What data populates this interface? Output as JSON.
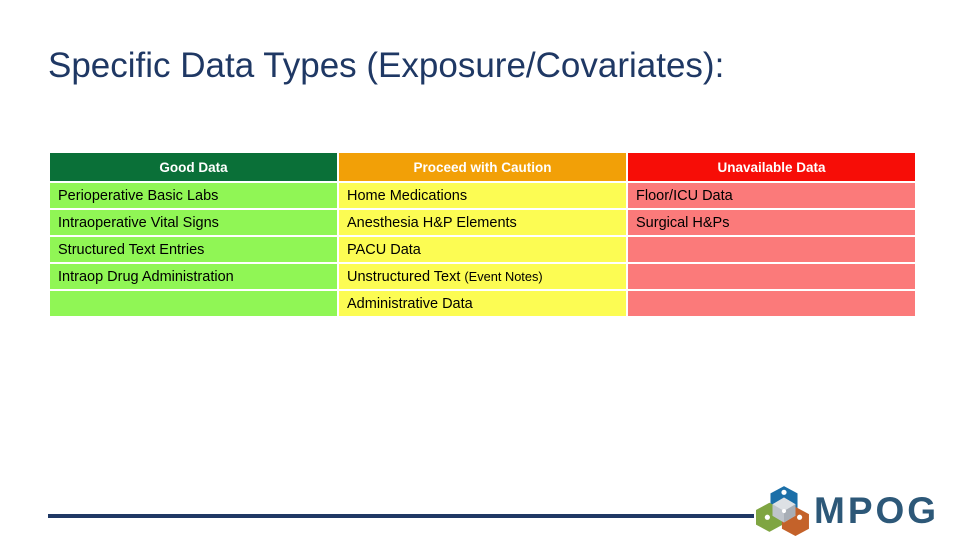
{
  "slide": {
    "title": "Specific Data Types (Exposure/Covariates):",
    "background_color": "#FFFFFF",
    "title_color": "#1F3864"
  },
  "table": {
    "headers": [
      {
        "label": "Good Data",
        "color": "#0A7038"
      },
      {
        "label": "Proceed with Caution",
        "color": "#F2A007"
      },
      {
        "label": "Unavailable Data",
        "color": "#F70D07"
      }
    ],
    "cell_colors": {
      "good": "#90F655",
      "caution": "#FCFC53",
      "unavailable": "#FB7A7A"
    },
    "rows": [
      {
        "good": "Perioperative Basic Labs",
        "caution": "Home Medications",
        "unavailable": "Floor/ICU Data"
      },
      {
        "good": "Intraoperative Vital Signs",
        "caution": "Anesthesia H&P Elements",
        "unavailable": "Surgical H&Ps"
      },
      {
        "good": "Structured Text Entries",
        "caution": "PACU Data",
        "unavailable": ""
      },
      {
        "good": "Intraop Drug Administration",
        "caution": "Unstructured Text ",
        "caution_note": "(Event Notes)",
        "unavailable": ""
      },
      {
        "good": "",
        "caution": "Administrative Data",
        "unavailable": ""
      }
    ]
  },
  "footer": {
    "rule_color": "#1F3864",
    "logo_wordmark": "MPOG",
    "logo_text_color": "#2D5878",
    "logo_icon": "mpog-cube-logo-icon"
  }
}
